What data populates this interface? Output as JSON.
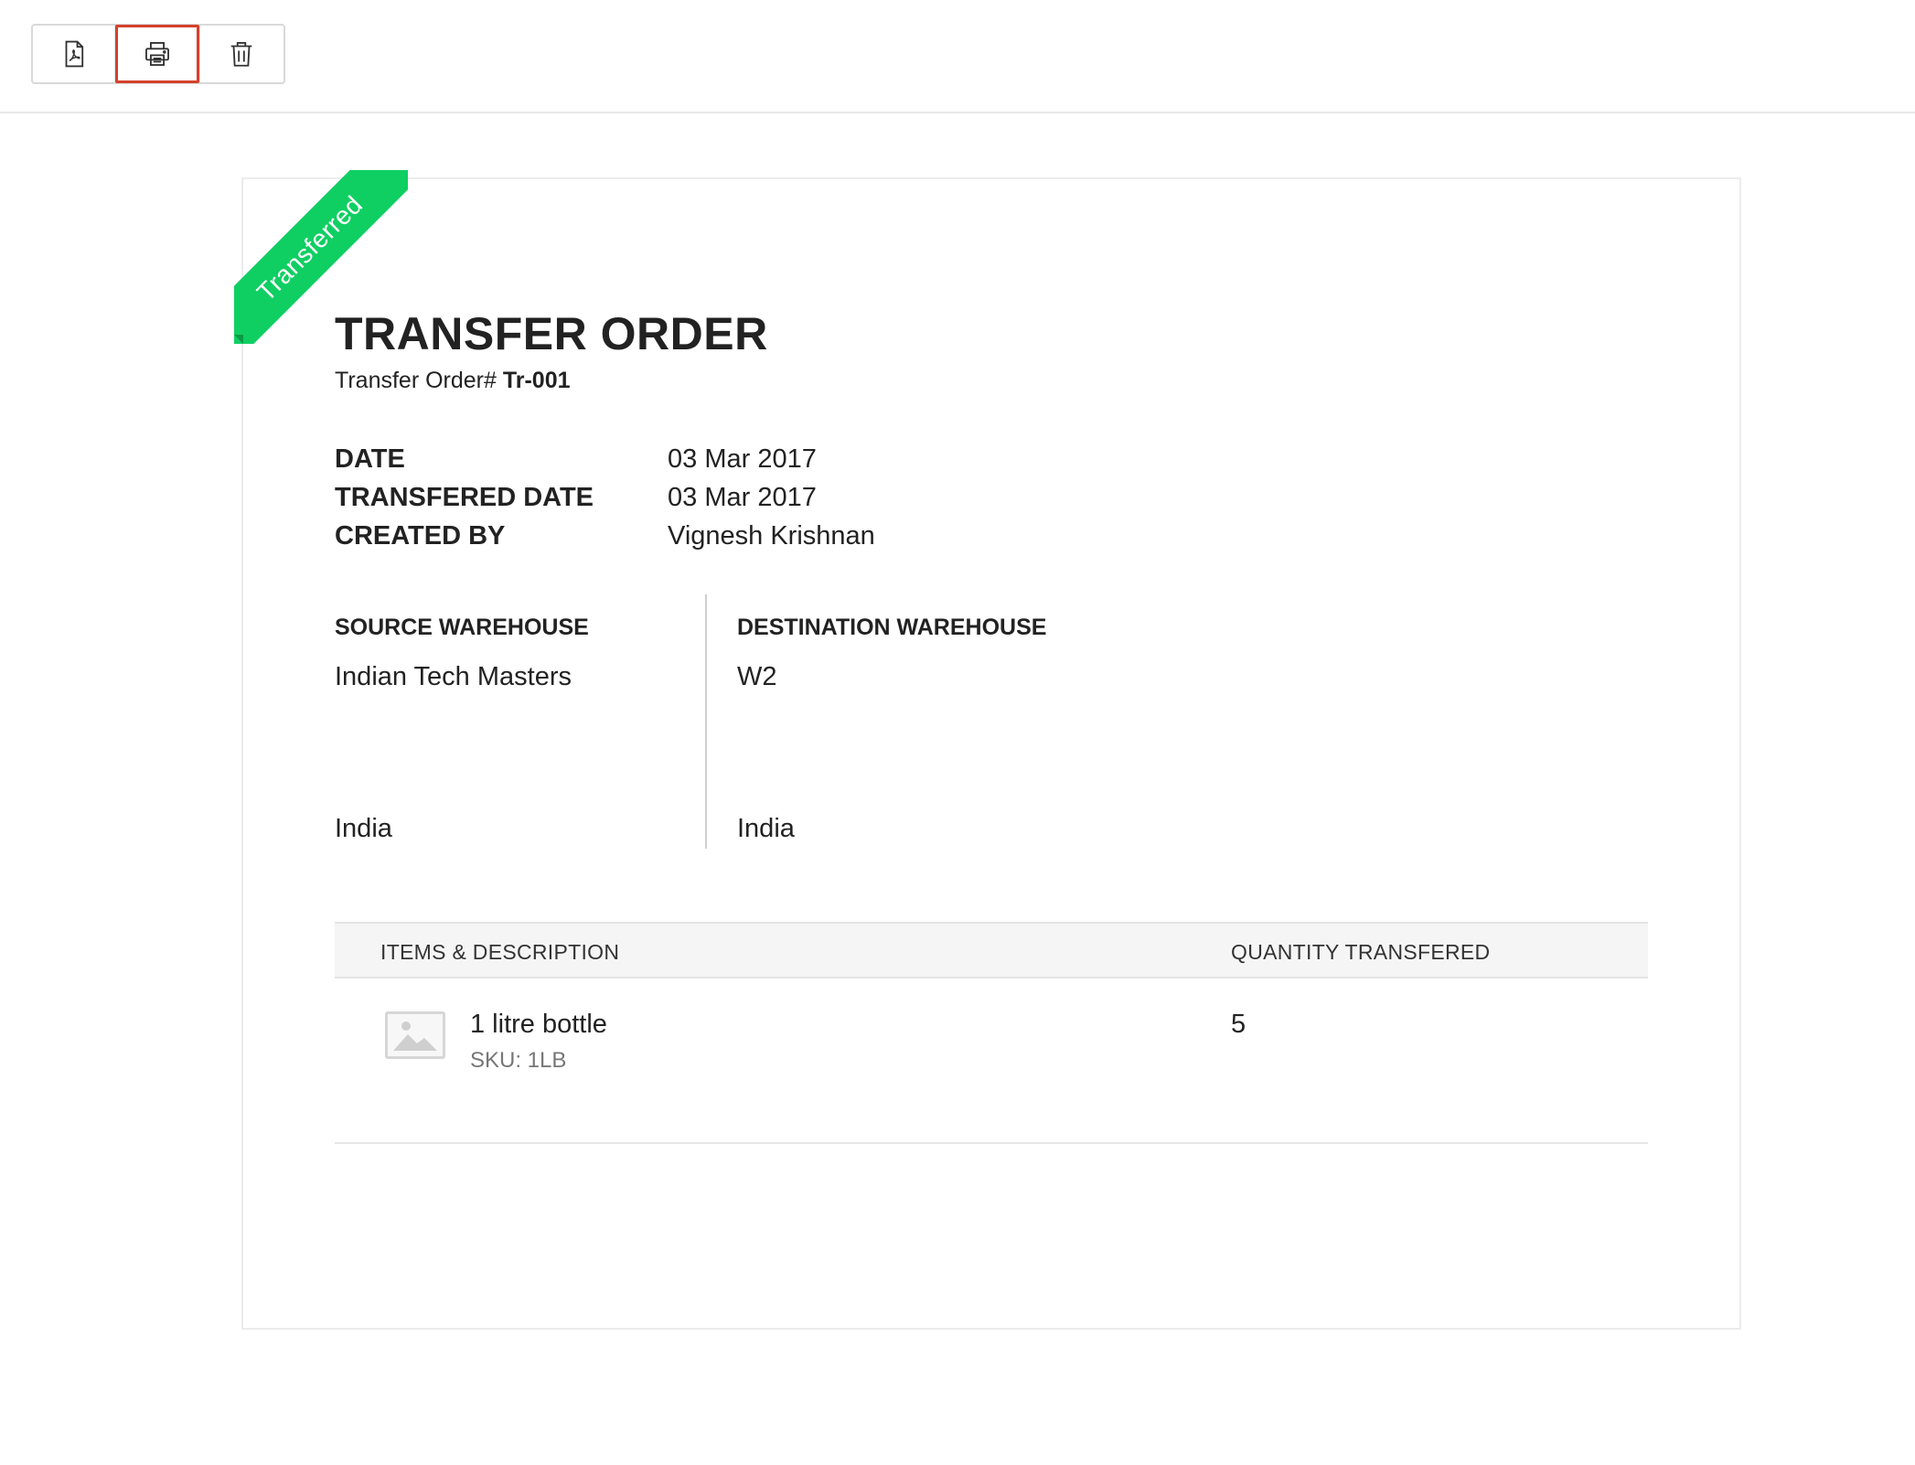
{
  "toolbar": {
    "buttons": [
      {
        "icon": "pdf-icon",
        "active": false
      },
      {
        "icon": "printer-icon",
        "active": true
      },
      {
        "icon": "trash-icon",
        "active": false
      }
    ],
    "active_border_color": "#d5412c"
  },
  "document": {
    "status_ribbon": "Transferred",
    "status_color": "#0fcf62",
    "title": "TRANSFER ORDER",
    "order_number_label": "Transfer Order#",
    "order_number": "Tr-001",
    "meta": [
      {
        "label": "DATE",
        "value": "03 Mar 2017"
      },
      {
        "label": "TRANSFERED DATE",
        "value": "03 Mar 2017"
      },
      {
        "label": "CREATED BY",
        "value": "Vignesh Krishnan"
      }
    ],
    "source_warehouse": {
      "label": "SOURCE WAREHOUSE",
      "name": "Indian Tech Masters",
      "country": "India"
    },
    "destination_warehouse": {
      "label": "DESTINATION WAREHOUSE",
      "name": "W2",
      "country": "India"
    },
    "table": {
      "headers": [
        "ITEMS & DESCRIPTION",
        "QUANTITY TRANSFERED"
      ],
      "rows": [
        {
          "thumbnail_icon": "image-placeholder-icon",
          "name": "1 litre bottle",
          "sku": "SKU: 1LB",
          "quantity": "5"
        }
      ]
    }
  }
}
